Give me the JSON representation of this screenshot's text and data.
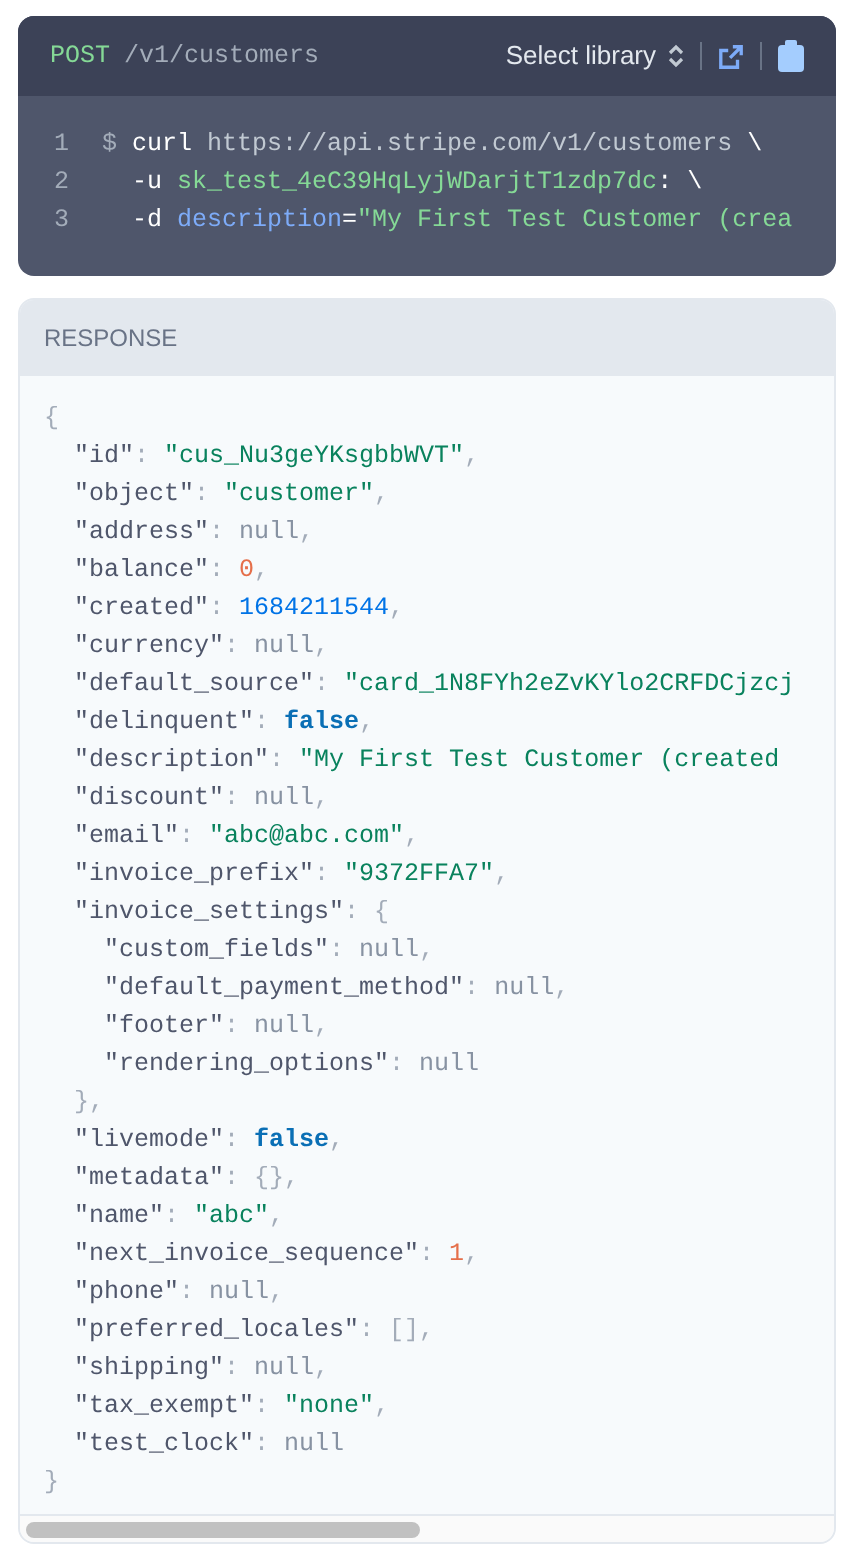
{
  "request": {
    "method": "POST",
    "path": "/v1/customers",
    "library_select": "Select library",
    "lines": [
      {
        "number": "1",
        "tokens": [
          {
            "kind": "prompt",
            "text": "$ "
          },
          {
            "kind": "command",
            "text": "curl "
          },
          {
            "kind": "url",
            "text": "https://api.stripe.com/v1/customers "
          },
          {
            "kind": "command",
            "text": "\\"
          }
        ]
      },
      {
        "number": "2",
        "tokens": [
          {
            "kind": "command",
            "text": "  -u "
          },
          {
            "kind": "string",
            "text": "sk_test_4eC39HqLyjWDarjtT1zdp7dc"
          },
          {
            "kind": "command",
            "text": ": \\"
          }
        ]
      },
      {
        "number": "3",
        "tokens": [
          {
            "kind": "command",
            "text": "  -d "
          },
          {
            "kind": "param",
            "text": "description"
          },
          {
            "kind": "command",
            "text": "="
          },
          {
            "kind": "string",
            "text": "\"My First Test Customer (crea"
          }
        ]
      }
    ]
  },
  "response": {
    "title": "RESPONSE",
    "lines": [
      [
        {
          "kind": "punct",
          "text": "{"
        }
      ],
      [
        {
          "kind": "key",
          "text": "  \"id\""
        },
        {
          "kind": "punct",
          "text": ": "
        },
        {
          "kind": "string",
          "text": "\"cus_Nu3geYKsgbbWVT\""
        },
        {
          "kind": "punct",
          "text": ","
        }
      ],
      [
        {
          "kind": "key",
          "text": "  \"object\""
        },
        {
          "kind": "punct",
          "text": ": "
        },
        {
          "kind": "string",
          "text": "\"customer\""
        },
        {
          "kind": "punct",
          "text": ","
        }
      ],
      [
        {
          "kind": "key",
          "text": "  \"address\""
        },
        {
          "kind": "punct",
          "text": ": "
        },
        {
          "kind": "null",
          "text": "null"
        },
        {
          "kind": "punct",
          "text": ","
        }
      ],
      [
        {
          "kind": "key",
          "text": "  \"balance\""
        },
        {
          "kind": "punct",
          "text": ": "
        },
        {
          "kind": "number",
          "text": "0"
        },
        {
          "kind": "punct",
          "text": ","
        }
      ],
      [
        {
          "kind": "key",
          "text": "  \"created\""
        },
        {
          "kind": "punct",
          "text": ": "
        },
        {
          "kind": "timestamp",
          "text": "1684211544"
        },
        {
          "kind": "punct",
          "text": ","
        }
      ],
      [
        {
          "kind": "key",
          "text": "  \"currency\""
        },
        {
          "kind": "punct",
          "text": ": "
        },
        {
          "kind": "null",
          "text": "null"
        },
        {
          "kind": "punct",
          "text": ","
        }
      ],
      [
        {
          "kind": "key",
          "text": "  \"default_source\""
        },
        {
          "kind": "punct",
          "text": ": "
        },
        {
          "kind": "string",
          "text": "\"card_1N8FYh2eZvKYlo2CRFDCjzcj"
        }
      ],
      [
        {
          "kind": "key",
          "text": "  \"delinquent\""
        },
        {
          "kind": "punct",
          "text": ": "
        },
        {
          "kind": "bool",
          "text": "false"
        },
        {
          "kind": "punct",
          "text": ","
        }
      ],
      [
        {
          "kind": "key",
          "text": "  \"description\""
        },
        {
          "kind": "punct",
          "text": ": "
        },
        {
          "kind": "string",
          "text": "\"My First Test Customer (created"
        }
      ],
      [
        {
          "kind": "key",
          "text": "  \"discount\""
        },
        {
          "kind": "punct",
          "text": ": "
        },
        {
          "kind": "null",
          "text": "null"
        },
        {
          "kind": "punct",
          "text": ","
        }
      ],
      [
        {
          "kind": "key",
          "text": "  \"email\""
        },
        {
          "kind": "punct",
          "text": ": "
        },
        {
          "kind": "string",
          "text": "\"abc@abc.com\""
        },
        {
          "kind": "punct",
          "text": ","
        }
      ],
      [
        {
          "kind": "key",
          "text": "  \"invoice_prefix\""
        },
        {
          "kind": "punct",
          "text": ": "
        },
        {
          "kind": "string",
          "text": "\"9372FFA7\""
        },
        {
          "kind": "punct",
          "text": ","
        }
      ],
      [
        {
          "kind": "key",
          "text": "  \"invoice_settings\""
        },
        {
          "kind": "punct",
          "text": ": {"
        }
      ],
      [
        {
          "kind": "key",
          "text": "    \"custom_fields\""
        },
        {
          "kind": "punct",
          "text": ": "
        },
        {
          "kind": "null",
          "text": "null"
        },
        {
          "kind": "punct",
          "text": ","
        }
      ],
      [
        {
          "kind": "key",
          "text": "    \"default_payment_method\""
        },
        {
          "kind": "punct",
          "text": ": "
        },
        {
          "kind": "null",
          "text": "null"
        },
        {
          "kind": "punct",
          "text": ","
        }
      ],
      [
        {
          "kind": "key",
          "text": "    \"footer\""
        },
        {
          "kind": "punct",
          "text": ": "
        },
        {
          "kind": "null",
          "text": "null"
        },
        {
          "kind": "punct",
          "text": ","
        }
      ],
      [
        {
          "kind": "key",
          "text": "    \"rendering_options\""
        },
        {
          "kind": "punct",
          "text": ": "
        },
        {
          "kind": "null",
          "text": "null"
        }
      ],
      [
        {
          "kind": "punct",
          "text": "  },"
        }
      ],
      [
        {
          "kind": "key",
          "text": "  \"livemode\""
        },
        {
          "kind": "punct",
          "text": ": "
        },
        {
          "kind": "bool",
          "text": "false"
        },
        {
          "kind": "punct",
          "text": ","
        }
      ],
      [
        {
          "kind": "key",
          "text": "  \"metadata\""
        },
        {
          "kind": "punct",
          "text": ": {},"
        }
      ],
      [
        {
          "kind": "key",
          "text": "  \"name\""
        },
        {
          "kind": "punct",
          "text": ": "
        },
        {
          "kind": "string",
          "text": "\"abc\""
        },
        {
          "kind": "punct",
          "text": ","
        }
      ],
      [
        {
          "kind": "key",
          "text": "  \"next_invoice_sequence\""
        },
        {
          "kind": "punct",
          "text": ": "
        },
        {
          "kind": "number",
          "text": "1"
        },
        {
          "kind": "punct",
          "text": ","
        }
      ],
      [
        {
          "kind": "key",
          "text": "  \"phone\""
        },
        {
          "kind": "punct",
          "text": ": "
        },
        {
          "kind": "null",
          "text": "null"
        },
        {
          "kind": "punct",
          "text": ","
        }
      ],
      [
        {
          "kind": "key",
          "text": "  \"preferred_locales\""
        },
        {
          "kind": "punct",
          "text": ": [],"
        }
      ],
      [
        {
          "kind": "key",
          "text": "  \"shipping\""
        },
        {
          "kind": "punct",
          "text": ": "
        },
        {
          "kind": "null",
          "text": "null"
        },
        {
          "kind": "punct",
          "text": ","
        }
      ],
      [
        {
          "kind": "key",
          "text": "  \"tax_exempt\""
        },
        {
          "kind": "punct",
          "text": ": "
        },
        {
          "kind": "string",
          "text": "\"none\""
        },
        {
          "kind": "punct",
          "text": ","
        }
      ],
      [
        {
          "kind": "key",
          "text": "  \"test_clock\""
        },
        {
          "kind": "punct",
          "text": ": "
        },
        {
          "kind": "null",
          "text": "null"
        }
      ],
      [
        {
          "kind": "punct",
          "text": "}"
        }
      ]
    ]
  }
}
